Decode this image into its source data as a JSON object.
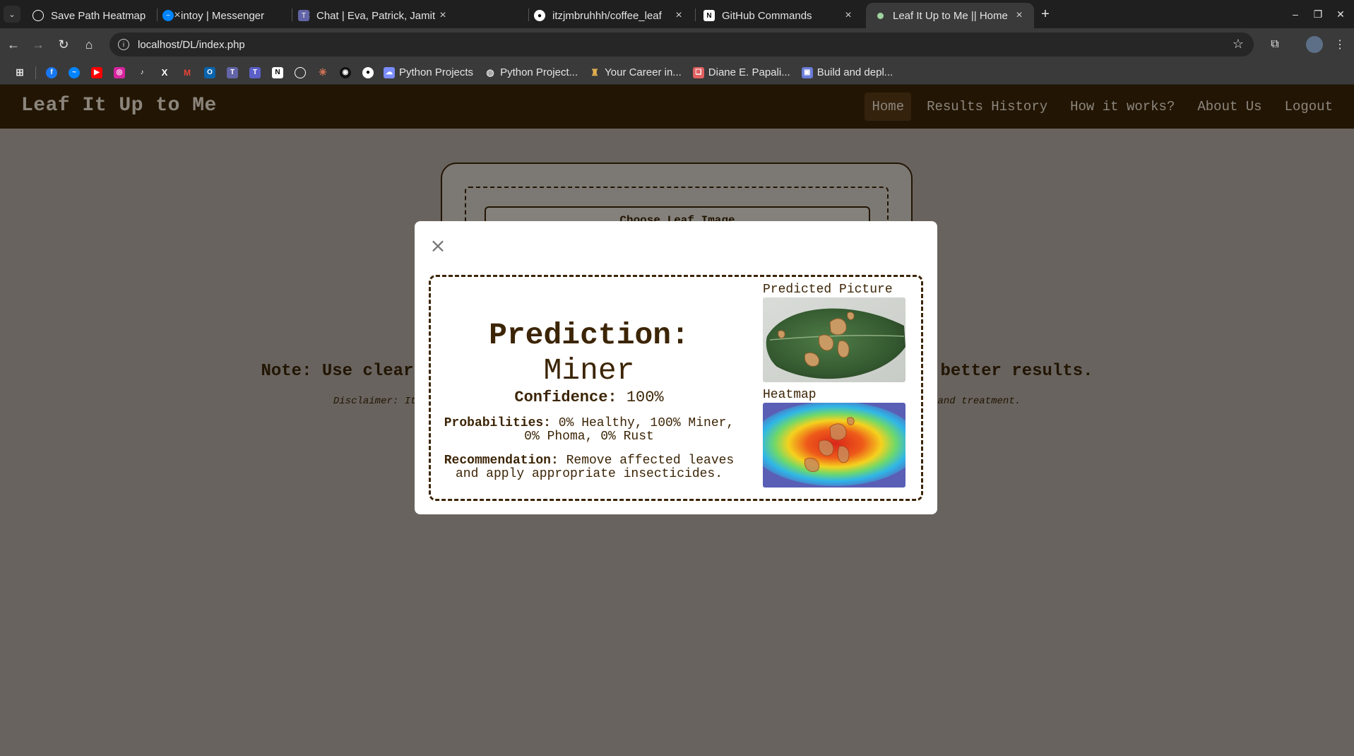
{
  "browser": {
    "tabs": [
      {
        "title": "Save Path Heatmap",
        "icon": "openai-icon",
        "color": "#ffffff"
      },
      {
        "title": "intoy | Messenger",
        "icon": "messenger-icon",
        "color": "#0084ff"
      },
      {
        "title": "Chat | Eva, Patrick, Jamit",
        "icon": "teams-icon",
        "color": "#6264a7"
      },
      {
        "title": "itzjmbruhhh/coffee_leaf",
        "icon": "github-icon",
        "color": "#ffffff"
      },
      {
        "title": "GitHub Commands",
        "icon": "notion-icon",
        "color": "#ffffff"
      },
      {
        "title": "Leaf It Up to Me || Home",
        "icon": "page-icon",
        "color": "#9fd39f"
      }
    ],
    "address": "localhost/DL/index.php",
    "bookmarks": [
      {
        "label": "Python Projects",
        "icon": "drive-icon",
        "color": "#7b8cff"
      },
      {
        "label": "Python Project...",
        "icon": "globe-icon",
        "color": "#dddddd"
      },
      {
        "label": "Your Career in...",
        "icon": "career-icon",
        "color": "#e0b050"
      },
      {
        "label": "Diane E. Papali...",
        "icon": "book-icon",
        "color": "#e06060"
      },
      {
        "label": "Build and depl...",
        "icon": "deploy-icon",
        "color": "#6a7bd8"
      }
    ]
  },
  "site": {
    "brand": "Leaf It Up to Me",
    "nav": [
      "Home",
      "Results History",
      "How it works?",
      "About Us",
      "Logout"
    ],
    "active_nav": "Home",
    "choose_button": "Choose Leaf Image",
    "note_left": "Note: Use clear",
    "note_right": "better results.",
    "disclaimer_left": "Disclaimer: It",
    "disclaimer_right": "and treatment."
  },
  "modal": {
    "close_symbol": "×",
    "prediction_label": "Prediction:",
    "prediction_value": "Miner",
    "confidence_label": "Confidence:",
    "confidence_value": "100%",
    "probabilities_label": "Probabilities:",
    "probabilities_value": "0% Healthy, 100% Miner, 0% Phoma, 0% Rust",
    "recommendation_label": "Recommendation:",
    "recommendation_value": "Remove affected leaves and apply appropriate insecticides.",
    "predicted_picture_caption": "Predicted Picture",
    "heatmap_caption": "Heatmap"
  },
  "colors": {
    "brand_brown": "#3c2506",
    "page_bg": "#b3aba3",
    "chrome_dark": "#1f1f1f"
  }
}
